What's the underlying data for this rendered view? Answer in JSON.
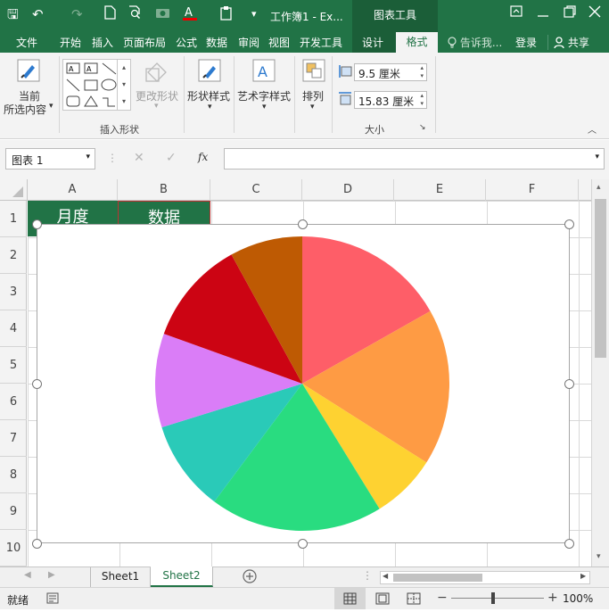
{
  "titlebar": {
    "title": "工作簿1 - Ex...",
    "contextual_tab": "图表工具",
    "qa_save": "🖫",
    "qa_undo": "↶",
    "qa_redo": "↷"
  },
  "tabs": [
    "文件",
    "开始",
    "插入",
    "页面布局",
    "公式",
    "数据",
    "审阅",
    "视图",
    "开发工具",
    "设计",
    "格式"
  ],
  "active_tab": "格式",
  "tell_me": "告诉我...",
  "login": "登录",
  "share": "共享",
  "ribbon": {
    "current_selection_line1": "当前",
    "current_selection_line2": "所选内容",
    "change_shape": "更改形状",
    "insert_shapes_group": "插入形状",
    "shape_styles": "形状样式",
    "wordart_styles": "艺术字样式",
    "arrange": "排列",
    "height_value": "9.5 厘米",
    "width_value": "15.83 厘米",
    "size_group": "大小"
  },
  "formula_bar": {
    "name_box": "图表 1",
    "fx": "fx",
    "content": ""
  },
  "columns": [
    "A",
    "B",
    "C",
    "D",
    "E",
    "F"
  ],
  "rows": [
    "1",
    "2",
    "3",
    "4",
    "5",
    "6",
    "7",
    "8",
    "9",
    "10"
  ],
  "cells": {
    "a1": "月度",
    "b1": "数据"
  },
  "sheets": [
    "Sheet1",
    "Sheet2"
  ],
  "active_sheet": "Sheet2",
  "status": {
    "ready": "就绪",
    "zoom": "100%"
  },
  "chart_data": {
    "type": "pie",
    "title": "",
    "slices": [
      {
        "value": 16.8,
        "color": "#fe5e68"
      },
      {
        "value": 17.2,
        "color": "#fe9b44"
      },
      {
        "value": 7.2,
        "color": "#fed231"
      },
      {
        "value": 19.0,
        "color": "#29dc80"
      },
      {
        "value": 10.0,
        "color": "#2acab8"
      },
      {
        "value": 10.3,
        "color": "#da7df7"
      },
      {
        "value": 11.5,
        "color": "#cc0413"
      },
      {
        "value": 8.0,
        "color": "#be5a03"
      }
    ]
  }
}
